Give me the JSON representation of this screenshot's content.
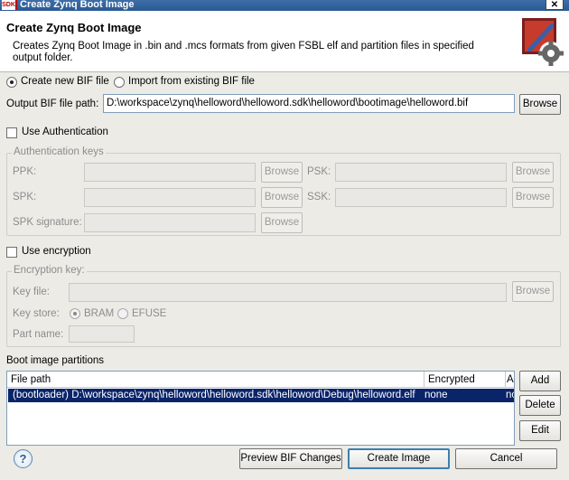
{
  "window": {
    "app_badge": "SDK",
    "title": "Create Zynq Boot Image",
    "close_glyph": "✕"
  },
  "header": {
    "title": "Create Zynq Boot Image",
    "description": "Creates Zynq Boot Image in .bin and .mcs formats from given FSBL elf and partition files in specified output folder.",
    "logo_icon": "gear-icon"
  },
  "bif_mode": {
    "create_label": "Create new BIF file",
    "import_label": "Import from existing BIF file",
    "selected": "create"
  },
  "output_bif": {
    "label": "Output BIF file path:",
    "value": "D:\\workspace\\zynq\\helloword\\helloword.sdk\\helloword\\bootimage\\helloword.bif",
    "browse_label": "Browse"
  },
  "authentication": {
    "checkbox_label": "Use Authentication",
    "checked": false,
    "group_title": "Authentication keys",
    "ppk_label": "PPK:",
    "psk_label": "PSK:",
    "spk_label": "SPK:",
    "ssk_label": "SSK:",
    "spk_signature_label": "SPK signature:",
    "browse_label": "Browse"
  },
  "encryption": {
    "checkbox_label": "Use encryption",
    "checked": false,
    "group_title": "Encryption key:",
    "key_file_label": "Key file:",
    "browse_label": "Browse",
    "key_store_label": "Key store:",
    "bram_label": "BRAM",
    "efuse_label": "EFUSE",
    "key_store_selected": "BRAM",
    "part_name_label": "Part name:"
  },
  "partitions": {
    "section_label": "Boot image partitions",
    "columns": [
      "File path",
      "Encrypted",
      "Au"
    ],
    "rows": [
      {
        "file_path": "(bootloader) D:\\workspace\\zynq\\helloword\\helloword.sdk\\helloword\\Debug\\helloword.elf",
        "encrypted": "none",
        "auth": "no"
      }
    ],
    "add_label": "Add",
    "delete_label": "Delete",
    "edit_label": "Edit"
  },
  "footer": {
    "help_glyph": "?",
    "preview_label": "Preview BIF Changes",
    "create_label": "Create Image",
    "cancel_label": "Cancel"
  },
  "colors": {
    "title_bar": "#2b5a93",
    "dialog_bg": "#ecebe6",
    "selection": "#0a246a"
  }
}
